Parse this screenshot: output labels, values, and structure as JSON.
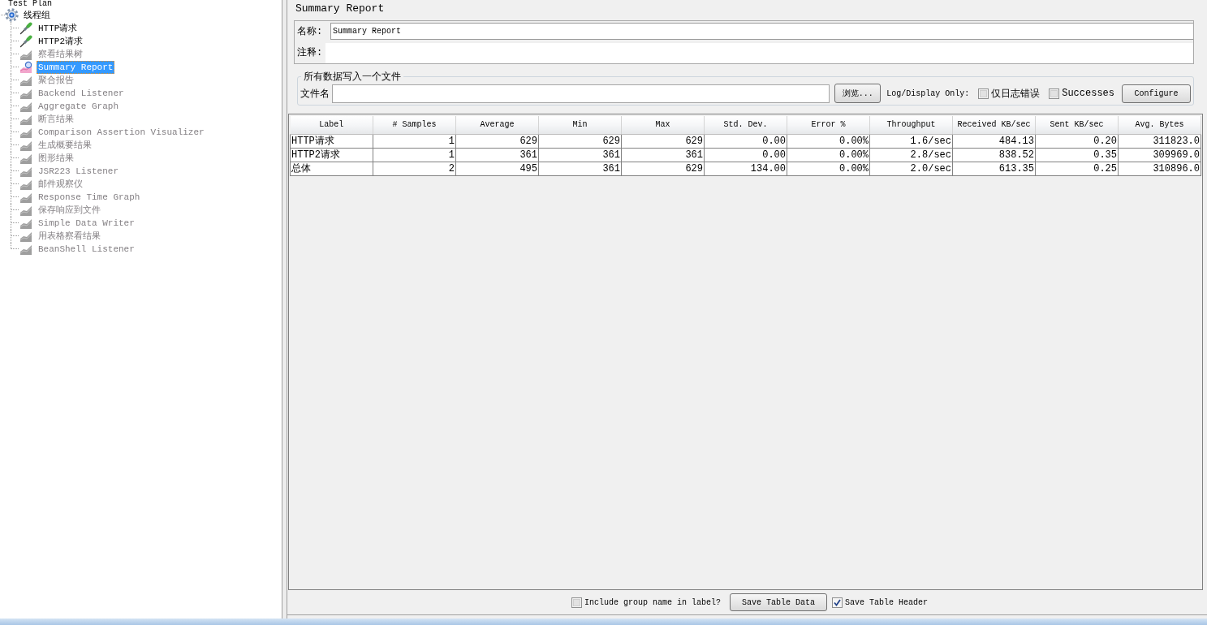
{
  "tree": {
    "label": "Test Plan",
    "selected": false,
    "disabled": false,
    "children": [
      {
        "label": "线程组",
        "kind": "thread-group",
        "selected": false,
        "disabled": false,
        "children": [
          {
            "label": "HTTP请求",
            "kind": "sampler",
            "selected": false,
            "disabled": false
          },
          {
            "label": "HTTP2请求",
            "kind": "sampler",
            "selected": false,
            "disabled": false
          },
          {
            "label": "察看结果树",
            "kind": "listener",
            "selected": false,
            "disabled": true
          },
          {
            "label": "Summary Report",
            "kind": "listener",
            "selected": true,
            "disabled": false
          },
          {
            "label": "聚合报告",
            "kind": "listener",
            "selected": false,
            "disabled": true
          },
          {
            "label": "Backend Listener",
            "kind": "listener",
            "selected": false,
            "disabled": true
          },
          {
            "label": "Aggregate Graph",
            "kind": "listener",
            "selected": false,
            "disabled": true
          },
          {
            "label": "断言结果",
            "kind": "listener",
            "selected": false,
            "disabled": true
          },
          {
            "label": "Comparison Assertion Visualizer",
            "kind": "listener",
            "selected": false,
            "disabled": true
          },
          {
            "label": "生成概要结果",
            "kind": "listener",
            "selected": false,
            "disabled": true
          },
          {
            "label": "图形结果",
            "kind": "listener",
            "selected": false,
            "disabled": true
          },
          {
            "label": "JSR223 Listener",
            "kind": "listener",
            "selected": false,
            "disabled": true
          },
          {
            "label": "邮件观察仪",
            "kind": "listener",
            "selected": false,
            "disabled": true
          },
          {
            "label": "Response Time Graph",
            "kind": "listener",
            "selected": false,
            "disabled": true
          },
          {
            "label": "保存响应到文件",
            "kind": "listener",
            "selected": false,
            "disabled": true
          },
          {
            "label": "Simple Data Writer",
            "kind": "listener",
            "selected": false,
            "disabled": true
          },
          {
            "label": "用表格察看结果",
            "kind": "listener",
            "selected": false,
            "disabled": true
          },
          {
            "label": "BeanShell Listener",
            "kind": "listener",
            "selected": false,
            "disabled": true
          }
        ]
      }
    ]
  },
  "form": {
    "title": "Summary Report",
    "name_label": "名称:",
    "name_value": "Summary Report",
    "comment_label": "注释:"
  },
  "file_panel": {
    "legend": "所有数据写入一个文件",
    "filename_label": "文件名",
    "browse_button": "浏览...",
    "log_label": "Log/Display Only:",
    "options": [
      {
        "label": "仅日志错误",
        "checked": false
      },
      {
        "label": "Successes",
        "checked": false
      }
    ],
    "configure_button": "Configure"
  },
  "table": {
    "columns": [
      "Label",
      "# Samples",
      "Average",
      "Min",
      "Max",
      "Std. Dev.",
      "Error %",
      "Throughput",
      "Received KB/sec",
      "Sent KB/sec",
      "Avg. Bytes"
    ],
    "rows": [
      [
        "HTTP请求",
        "1",
        "629",
        "629",
        "629",
        "0.00",
        "0.00%",
        "1.6/sec",
        "484.13",
        "0.20",
        "311823.0"
      ],
      [
        "HTTP2请求",
        "1",
        "361",
        "361",
        "361",
        "0.00",
        "0.00%",
        "2.8/sec",
        "838.52",
        "0.35",
        "309969.0"
      ],
      [
        "总体",
        "2",
        "495",
        "361",
        "629",
        "134.00",
        "0.00%",
        "2.0/sec",
        "613.35",
        "0.25",
        "310896.0"
      ]
    ]
  },
  "footer": {
    "include_group": {
      "label": "Include group name in label?",
      "checked": false
    },
    "save_data_button": "Save Table Data",
    "save_header": {
      "label": "Save Table Header",
      "checked": true
    }
  }
}
